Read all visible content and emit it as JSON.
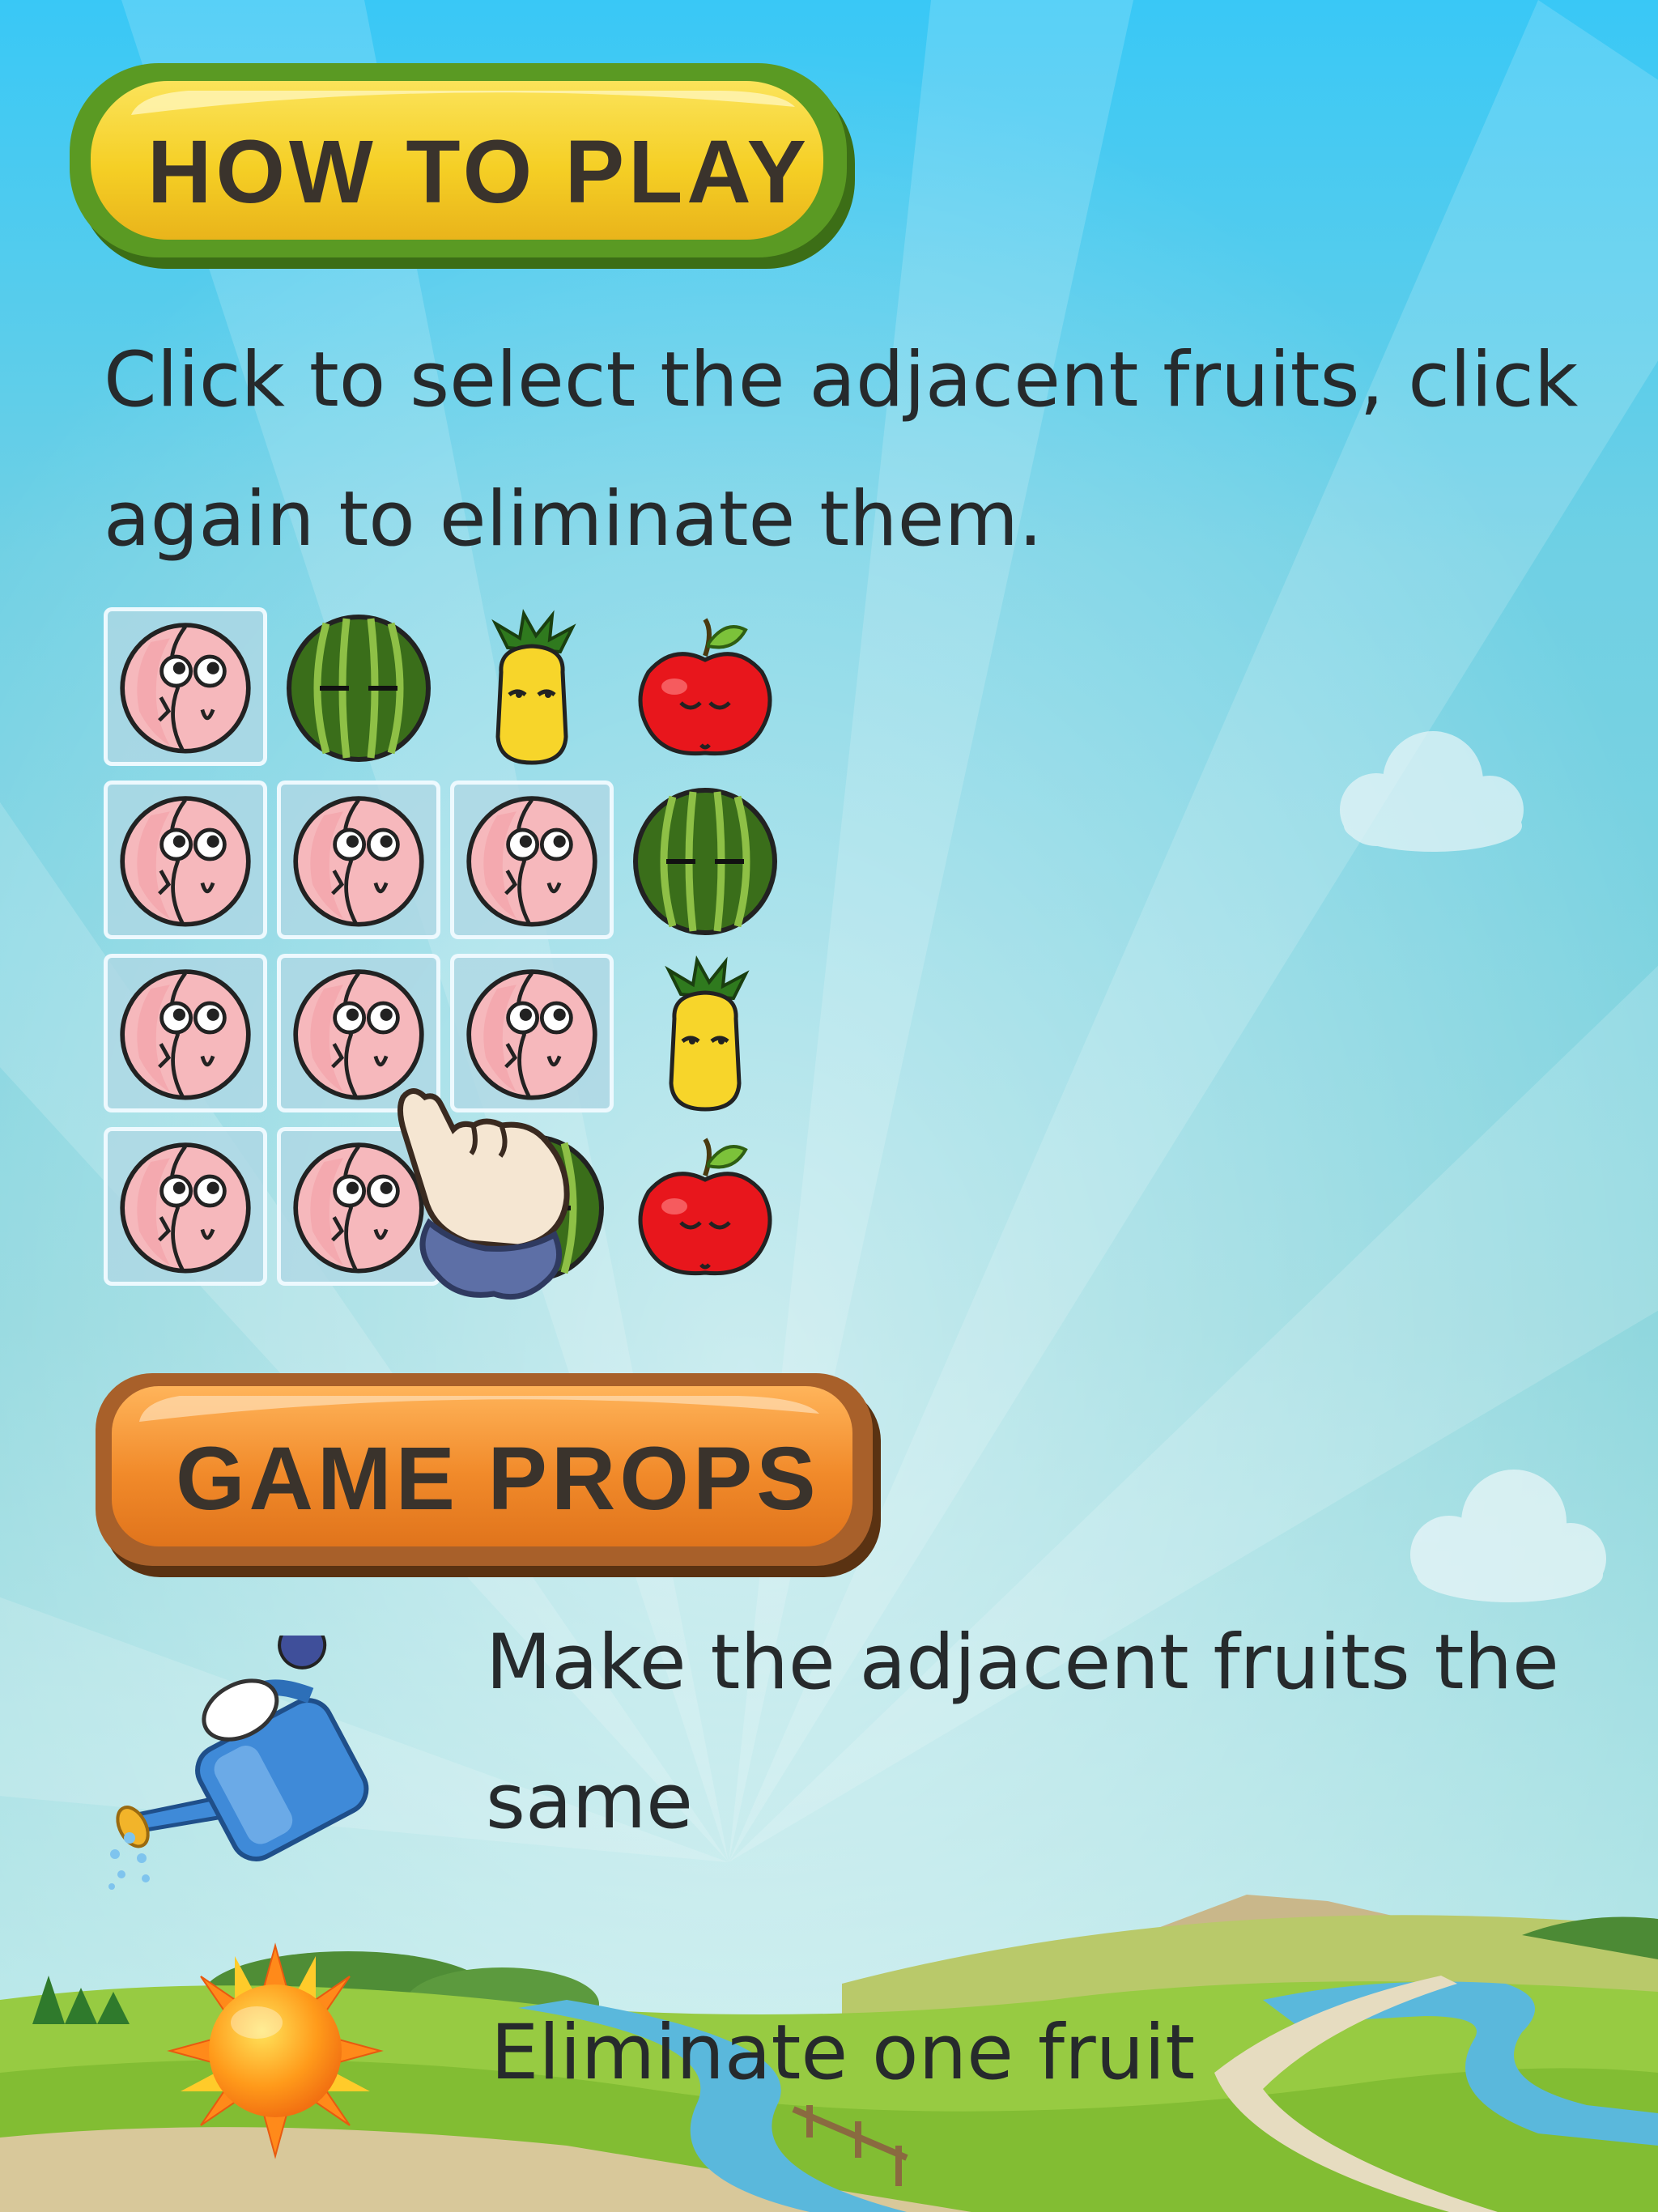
{
  "how_to_play": {
    "title": "HOW TO PLAY",
    "instruction": "Click to select the adjacent fruits, click again to eliminate them."
  },
  "board": {
    "rows": [
      [
        {
          "fruit": "peach",
          "selected": true
        },
        {
          "fruit": "watermelon",
          "selected": false
        },
        {
          "fruit": "pineapple",
          "selected": false
        },
        {
          "fruit": "apple",
          "selected": false
        }
      ],
      [
        {
          "fruit": "peach",
          "selected": true
        },
        {
          "fruit": "peach",
          "selected": true
        },
        {
          "fruit": "peach",
          "selected": true
        },
        {
          "fruit": "watermelon",
          "selected": false
        }
      ],
      [
        {
          "fruit": "peach",
          "selected": true
        },
        {
          "fruit": "peach",
          "selected": true
        },
        {
          "fruit": "peach",
          "selected": true
        },
        {
          "fruit": "pineapple",
          "selected": false
        }
      ],
      [
        {
          "fruit": "peach",
          "selected": true
        },
        {
          "fruit": "peach",
          "selected": true
        },
        {
          "fruit": "watermelon",
          "selected": false
        },
        {
          "fruit": "apple",
          "selected": false
        }
      ]
    ],
    "pointer_icon": "pointing-hand-icon"
  },
  "game_props": {
    "title": "GAME PROPS",
    "items": [
      {
        "icon": "watering-can-icon",
        "description": "Make the adjacent fruits the same"
      },
      {
        "icon": "sun-icon",
        "description": "Eliminate one fruit"
      }
    ]
  },
  "colors": {
    "sky_top": "#39c8f6",
    "sky_mid": "#7fd0da",
    "sky_bottom": "#b7e6ea",
    "yellow_button": "#f5d12b",
    "yellow_button_border": "#4e8a1f",
    "orange_button": "#f0892a",
    "orange_button_border": "#8a4a1a",
    "text": "#262a2c",
    "grass": "#8fc63a",
    "river": "#5ab8dc"
  }
}
